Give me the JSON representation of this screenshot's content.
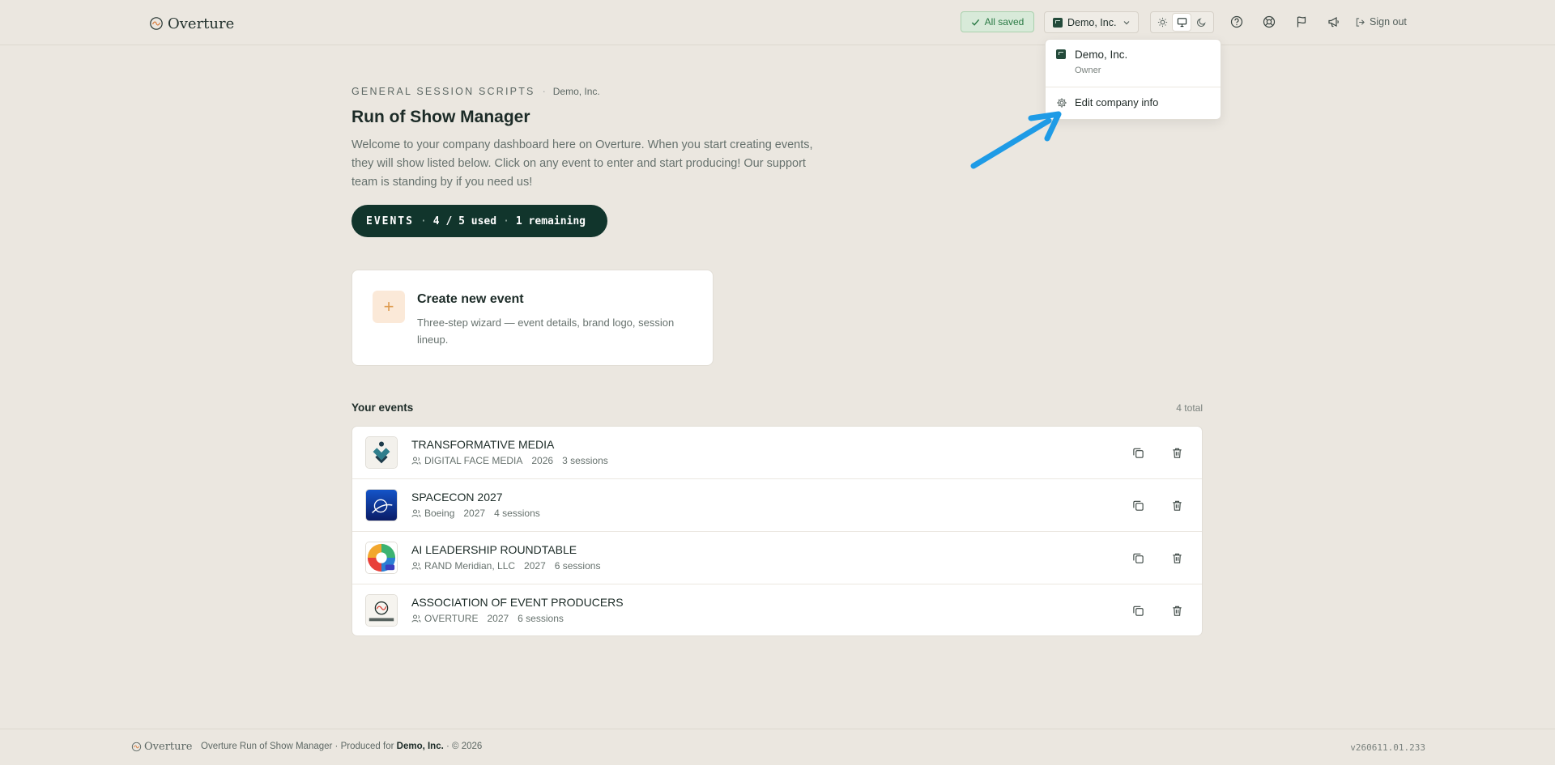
{
  "header": {
    "brand": "Overture",
    "saved_status": "All saved",
    "company_button": "Demo, Inc.",
    "theme_options": [
      "light",
      "system",
      "dark"
    ],
    "theme_selected": "system",
    "icons": [
      "help-icon",
      "support-icon",
      "flag-icon",
      "announce-icon"
    ],
    "signout_label": "Sign out"
  },
  "dropdown": {
    "company_name": "Demo, Inc.",
    "role": "Owner",
    "edit_label": "Edit company info"
  },
  "main": {
    "eyebrow": "GENERAL SESSION SCRIPTS",
    "eyebrow_company": "Demo, Inc.",
    "title": "Run of Show Manager",
    "intro": "Welcome to your company dashboard here on Overture. When you start creating events, they will show listed below. Click on any event to enter and start producing! Our support team is standing by if you need us!",
    "events_pill": {
      "label": "EVENTS",
      "used": "4 / 5 used",
      "remaining": "1 remaining"
    },
    "create_card": {
      "title": "Create new event",
      "description": "Three-step wizard — event details, brand logo, session lineup."
    },
    "events_heading": "Your events",
    "events_total": "4 total",
    "events": [
      {
        "title": "TRANSFORMATIVE MEDIA",
        "client": "DIGITAL FACE MEDIA",
        "year": "2026",
        "sessions": "3 sessions"
      },
      {
        "title": "SPACECON 2027",
        "client": "Boeing",
        "year": "2027",
        "sessions": "4 sessions"
      },
      {
        "title": "AI LEADERSHIP ROUNDTABLE",
        "client": "RAND Meridian, LLC",
        "year": "2027",
        "sessions": "6 sessions"
      },
      {
        "title": "ASSOCIATION OF EVENT PRODUCERS",
        "client": "OVERTURE",
        "year": "2027",
        "sessions": "6 sessions"
      }
    ]
  },
  "footer": {
    "brand": "Overture",
    "text_prefix": "Overture Run of Show Manager · Produced for",
    "company": "Demo, Inc.",
    "text_suffix": "· © 2026",
    "version": "v260611.01.233"
  },
  "colors": {
    "background": "#ebe7e0",
    "accent_dark": "#11352c",
    "saved_green": "#2a7a45",
    "annotation_blue": "#1e9be6",
    "plus_orange": "#de9a4e"
  }
}
